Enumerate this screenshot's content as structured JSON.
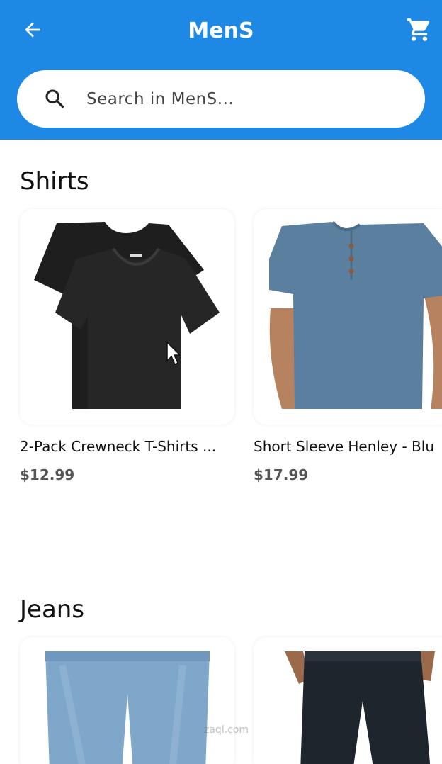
{
  "appbar": {
    "title": "MenS"
  },
  "search": {
    "placeholder": "Search in MenS..."
  },
  "sections": [
    {
      "title": "Shirts",
      "products": [
        {
          "name": "2-Pack Crewneck T-Shirts ...",
          "price": "$12.99"
        },
        {
          "name": "Short Sleeve Henley - Blu",
          "price": "$17.99"
        }
      ]
    },
    {
      "title": "Jeans",
      "products": [
        {
          "name": "",
          "price": ""
        },
        {
          "name": "",
          "price": ""
        }
      ]
    }
  ],
  "watermark": "zaql.com",
  "colors": {
    "accent": "#1e88e5",
    "henley": "#5b7f9e",
    "tshirt": "#222222"
  },
  "icons": {
    "back": "arrow-left-icon",
    "cart": "shopping-cart-icon",
    "search": "search-icon",
    "cursor": "mouse-cursor-icon"
  }
}
